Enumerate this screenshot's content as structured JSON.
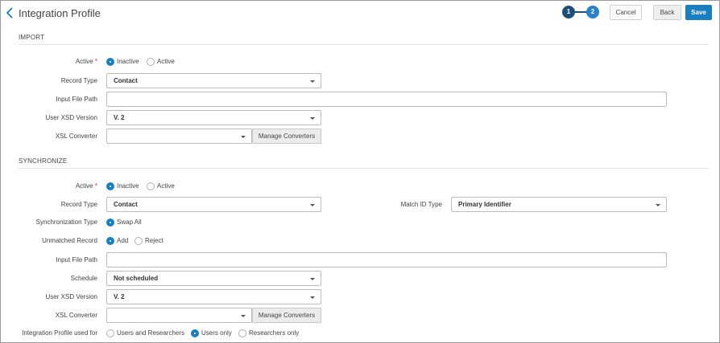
{
  "header": {
    "title": "Integration Profile",
    "steps": [
      "1",
      "2"
    ],
    "cancel_label": "Cancel",
    "back_label": "Back",
    "save_label": "Save"
  },
  "import": {
    "title": "IMPORT",
    "active_label": "Active",
    "active_options": [
      "Inactive",
      "Active"
    ],
    "record_type_label": "Record Type",
    "record_type_value": "Contact",
    "input_file_path_label": "Input File Path",
    "input_file_path_value": "",
    "user_xsd_label": "User XSD Version",
    "user_xsd_value": "V. 2",
    "xsl_converter_label": "XSL Converter",
    "xsl_converter_value": "",
    "manage_converters_label": "Manage Converters"
  },
  "sync": {
    "title": "SYNCHRONIZE",
    "active_label": "Active",
    "active_options": [
      "Inactive",
      "Active"
    ],
    "record_type_label": "Record Type",
    "record_type_value": "Contact",
    "match_id_label": "Match ID Type",
    "match_id_value": "Primary Identifier",
    "sync_type_label": "Synchronization Type",
    "sync_type_option": "Swap All",
    "unmatched_label": "Unmatched Record",
    "unmatched_options": [
      "Add",
      "Reject"
    ],
    "input_file_path_label": "Input File Path",
    "input_file_path_value": "",
    "schedule_label": "Schedule",
    "schedule_value": "Not scheduled",
    "user_xsd_label": "User XSD Version",
    "user_xsd_value": "V. 2",
    "xsl_converter_label": "XSL Converter",
    "xsl_converter_value": "",
    "manage_converters_label": "Manage Converters",
    "used_for_label": "Integration Profile used for",
    "used_for_options": [
      "Users and Researchers",
      "Users only",
      "Researchers only"
    ]
  },
  "colors": {
    "accent": "#1a7fc1",
    "step_done": "#1d4f7a",
    "step_current": "#2b82c6",
    "required": "#d0342c"
  }
}
